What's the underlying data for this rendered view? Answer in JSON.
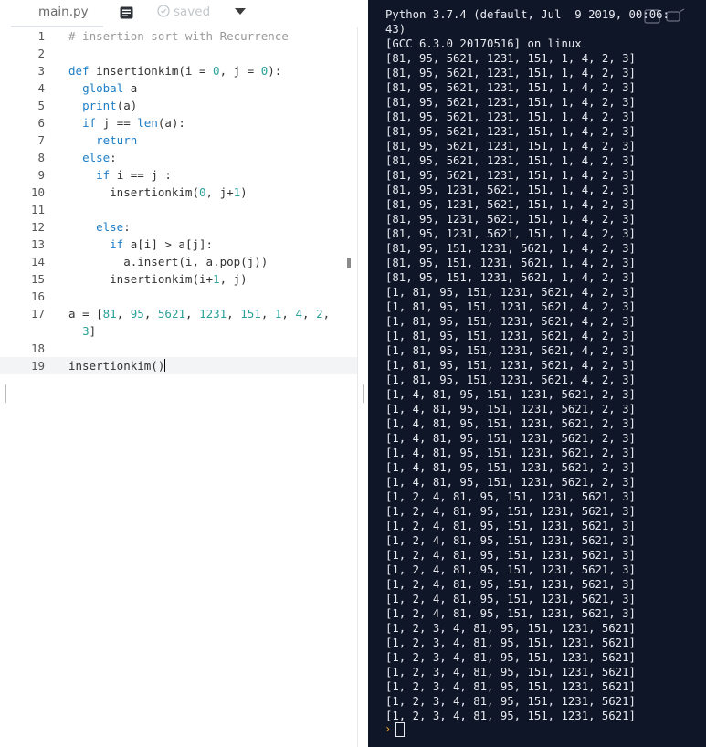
{
  "tabbar": {
    "filename": "main.py",
    "saved_label": "saved"
  },
  "editor": {
    "lines": [
      {
        "n": "1",
        "t": "# insertion sort with Recurrence"
      },
      {
        "n": "2",
        "t": ""
      },
      {
        "n": "3",
        "t": "def insertionkim(i = 0, j = 0):"
      },
      {
        "n": "4",
        "t": "  global a"
      },
      {
        "n": "5",
        "t": "  print(a)"
      },
      {
        "n": "6",
        "t": "  if j == len(a):"
      },
      {
        "n": "7",
        "t": "    return"
      },
      {
        "n": "8",
        "t": "  else:"
      },
      {
        "n": "9",
        "t": "    if i == j :"
      },
      {
        "n": "10",
        "t": "      insertionkim(0, j+1)"
      },
      {
        "n": "11",
        "t": ""
      },
      {
        "n": "12",
        "t": "    else:"
      },
      {
        "n": "13",
        "t": "      if a[i] > a[j]:"
      },
      {
        "n": "14",
        "t": "        a.insert(i, a.pop(j))"
      },
      {
        "n": "15",
        "t": "      insertionkim(i+1, j)"
      },
      {
        "n": "16",
        "t": ""
      },
      {
        "n": "17",
        "t": "a = [81, 95, 5621, 1231, 151, 1, 4, 2,"
      },
      {
        "n": "",
        "t": "  3]"
      },
      {
        "n": "18",
        "t": ""
      },
      {
        "n": "19",
        "t": "insertionkim()"
      }
    ]
  },
  "console": {
    "lines": [
      "Python 3.7.4 (default, Jul  9 2019, 00:06:",
      "43)",
      "[GCC 6.3.0 20170516] on linux",
      "[81, 95, 5621, 1231, 151, 1, 4, 2, 3]",
      "[81, 95, 5621, 1231, 151, 1, 4, 2, 3]",
      "[81, 95, 5621, 1231, 151, 1, 4, 2, 3]",
      "[81, 95, 5621, 1231, 151, 1, 4, 2, 3]",
      "[81, 95, 5621, 1231, 151, 1, 4, 2, 3]",
      "[81, 95, 5621, 1231, 151, 1, 4, 2, 3]",
      "[81, 95, 5621, 1231, 151, 1, 4, 2, 3]",
      "[81, 95, 5621, 1231, 151, 1, 4, 2, 3]",
      "[81, 95, 5621, 1231, 151, 1, 4, 2, 3]",
      "[81, 95, 1231, 5621, 151, 1, 4, 2, 3]",
      "[81, 95, 1231, 5621, 151, 1, 4, 2, 3]",
      "[81, 95, 1231, 5621, 151, 1, 4, 2, 3]",
      "[81, 95, 1231, 5621, 151, 1, 4, 2, 3]",
      "[81, 95, 151, 1231, 5621, 1, 4, 2, 3]",
      "[81, 95, 151, 1231, 5621, 1, 4, 2, 3]",
      "[81, 95, 151, 1231, 5621, 1, 4, 2, 3]",
      "[1, 81, 95, 151, 1231, 5621, 4, 2, 3]",
      "[1, 81, 95, 151, 1231, 5621, 4, 2, 3]",
      "[1, 81, 95, 151, 1231, 5621, 4, 2, 3]",
      "[1, 81, 95, 151, 1231, 5621, 4, 2, 3]",
      "[1, 81, 95, 151, 1231, 5621, 4, 2, 3]",
      "[1, 81, 95, 151, 1231, 5621, 4, 2, 3]",
      "[1, 81, 95, 151, 1231, 5621, 4, 2, 3]",
      "[1, 4, 81, 95, 151, 1231, 5621, 2, 3]",
      "[1, 4, 81, 95, 151, 1231, 5621, 2, 3]",
      "[1, 4, 81, 95, 151, 1231, 5621, 2, 3]",
      "[1, 4, 81, 95, 151, 1231, 5621, 2, 3]",
      "[1, 4, 81, 95, 151, 1231, 5621, 2, 3]",
      "[1, 4, 81, 95, 151, 1231, 5621, 2, 3]",
      "[1, 4, 81, 95, 151, 1231, 5621, 2, 3]",
      "[1, 2, 4, 81, 95, 151, 1231, 5621, 3]",
      "[1, 2, 4, 81, 95, 151, 1231, 5621, 3]",
      "[1, 2, 4, 81, 95, 151, 1231, 5621, 3]",
      "[1, 2, 4, 81, 95, 151, 1231, 5621, 3]",
      "[1, 2, 4, 81, 95, 151, 1231, 5621, 3]",
      "[1, 2, 4, 81, 95, 151, 1231, 5621, 3]",
      "[1, 2, 4, 81, 95, 151, 1231, 5621, 3]",
      "[1, 2, 4, 81, 95, 151, 1231, 5621, 3]",
      "[1, 2, 4, 81, 95, 151, 1231, 5621, 3]",
      "[1, 2, 3, 4, 81, 95, 151, 1231, 5621]",
      "[1, 2, 3, 4, 81, 95, 151, 1231, 5621]",
      "[1, 2, 3, 4, 81, 95, 151, 1231, 5621]",
      "[1, 2, 3, 4, 81, 95, 151, 1231, 5621]",
      "[1, 2, 3, 4, 81, 95, 151, 1231, 5621]",
      "[1, 2, 3, 4, 81, 95, 151, 1231, 5621]",
      "[1, 2, 3, 4, 81, 95, 151, 1231, 5621]"
    ],
    "prompt": "›"
  },
  "icons": {
    "notes": "notes-icon",
    "saved": "cloud-check-icon",
    "dropdown": "chevron-down-icon",
    "terminal_actions": "terminal-actions-icon"
  },
  "colors": {
    "terminal_bg": "#0f1628",
    "terminal_text": "#e8eaf0",
    "prompt": "#f0a030",
    "keyword": "#1e7ec6",
    "number": "#2aa198",
    "comment": "#9a9a9a"
  }
}
